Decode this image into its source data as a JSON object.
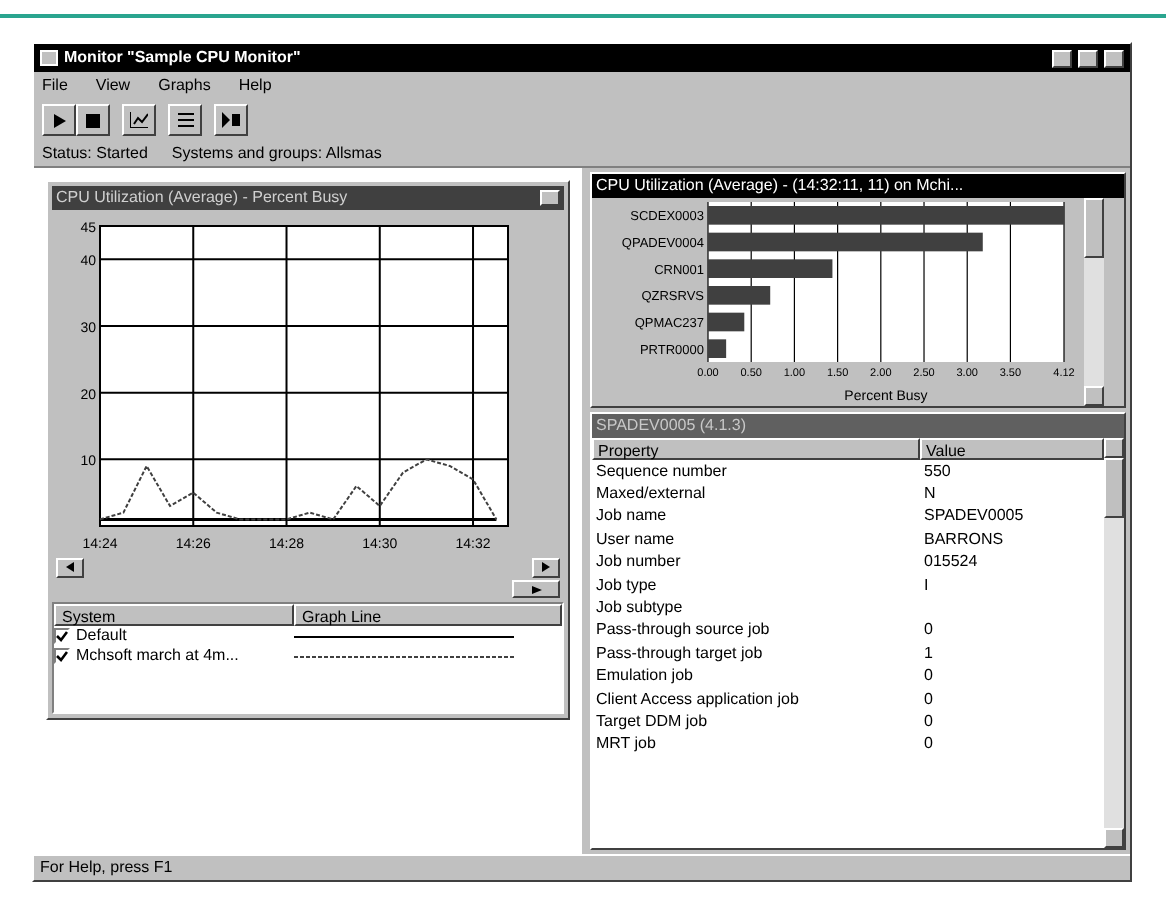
{
  "window": {
    "title": "Monitor \"Sample CPU Monitor\""
  },
  "menu": [
    "File",
    "View",
    "Graphs",
    "Help"
  ],
  "status_line": [
    "Status: Started",
    "Systems and groups: Allsmas"
  ],
  "graph_window": {
    "title": "CPU Utilization (Average) - Percent Busy",
    "chart_data": {
      "type": "line",
      "grid": true,
      "categories": [
        "14:24",
        null,
        null,
        null,
        "14:26",
        null,
        null,
        null,
        "14:28",
        null,
        null,
        null,
        "14:30",
        null,
        null,
        null,
        "14:32",
        null
      ],
      "ylim": [
        0,
        45
      ],
      "yticks": [
        {
          "value": 10,
          "label": "10"
        },
        {
          "value": 20,
          "label": "20"
        },
        {
          "value": 30,
          "label": "30"
        },
        {
          "value": 40,
          "label": "40"
        },
        {
          "value": 45,
          "label": "45"
        }
      ],
      "series": [
        {
          "name": "Default",
          "color": "#000000",
          "line_style": "solid",
          "values": [
            1,
            1,
            1,
            1,
            1,
            1,
            1,
            1,
            1,
            1,
            1,
            1,
            1,
            1,
            1,
            1,
            1,
            1
          ]
        },
        {
          "name": "Mchsoft march at 4m...",
          "color": "#404040",
          "line_style": "dashed",
          "values": [
            1,
            2,
            9,
            3,
            5,
            2,
            1,
            1,
            1,
            2,
            1,
            6,
            3,
            8,
            10,
            9,
            7,
            1
          ]
        }
      ]
    },
    "legend": {
      "columns": [
        "System",
        "Graph Line"
      ],
      "rows": [
        {
          "checked": true
        },
        {
          "checked": true
        }
      ]
    }
  },
  "bar_window": {
    "title": "CPU Utilization (Average) - (14:32:11, 11) on Mchi...",
    "chart_data": {
      "type": "bar",
      "orientation": "horizontal",
      "grid": true,
      "xlabel": "Percent Busy",
      "categories": [
        "SCDEX0003",
        "QPADEV0004",
        "CRN001",
        "QZRSRVS",
        "QPMAC237",
        "PRTR0000"
      ],
      "values": [
        4.12,
        3.18,
        1.44,
        0.72,
        0.42,
        0.21
      ],
      "xlim": [
        0,
        4.12
      ],
      "xticks": [
        {
          "value": 0,
          "label": "0.00"
        },
        {
          "value": 0.5,
          "label": "0.50"
        },
        {
          "value": 1,
          "label": "1.00"
        },
        {
          "value": 1.5,
          "label": "1.50"
        },
        {
          "value": 2,
          "label": "2.00"
        },
        {
          "value": 2.5,
          "label": "2.50"
        },
        {
          "value": 3,
          "label": "3.00"
        },
        {
          "value": 3.5,
          "label": "3.50"
        },
        {
          "value": 4.12,
          "label": "4.12"
        }
      ]
    }
  },
  "properties_window": {
    "title": "SPADEV0005 (4.1.3)",
    "columns": [
      "Property",
      "Value"
    ],
    "rows": [
      {
        "property": "Sequence number",
        "value": "550"
      },
      {
        "property": "Maxed/external",
        "value": "N"
      },
      {
        "property": "Job name",
        "value": "SPADEV0005"
      },
      {
        "property": "User name",
        "value": "BARRONS"
      },
      {
        "property": "Job number",
        "value": "015524"
      },
      {
        "property": "Job type",
        "value": "I"
      },
      {
        "property": "Job subtype"
      },
      {
        "property": "Pass-through source job",
        "value": "0"
      },
      {
        "property": "Pass-through target job",
        "value": "1"
      },
      {
        "property": "Emulation job",
        "value": "0"
      },
      {
        "property": "Client Access application job",
        "value": "0"
      },
      {
        "property": "Target DDM job",
        "value": "0"
      },
      {
        "property": "MRT job",
        "value": "0"
      }
    ]
  },
  "status_bar": "For Help, press F1"
}
